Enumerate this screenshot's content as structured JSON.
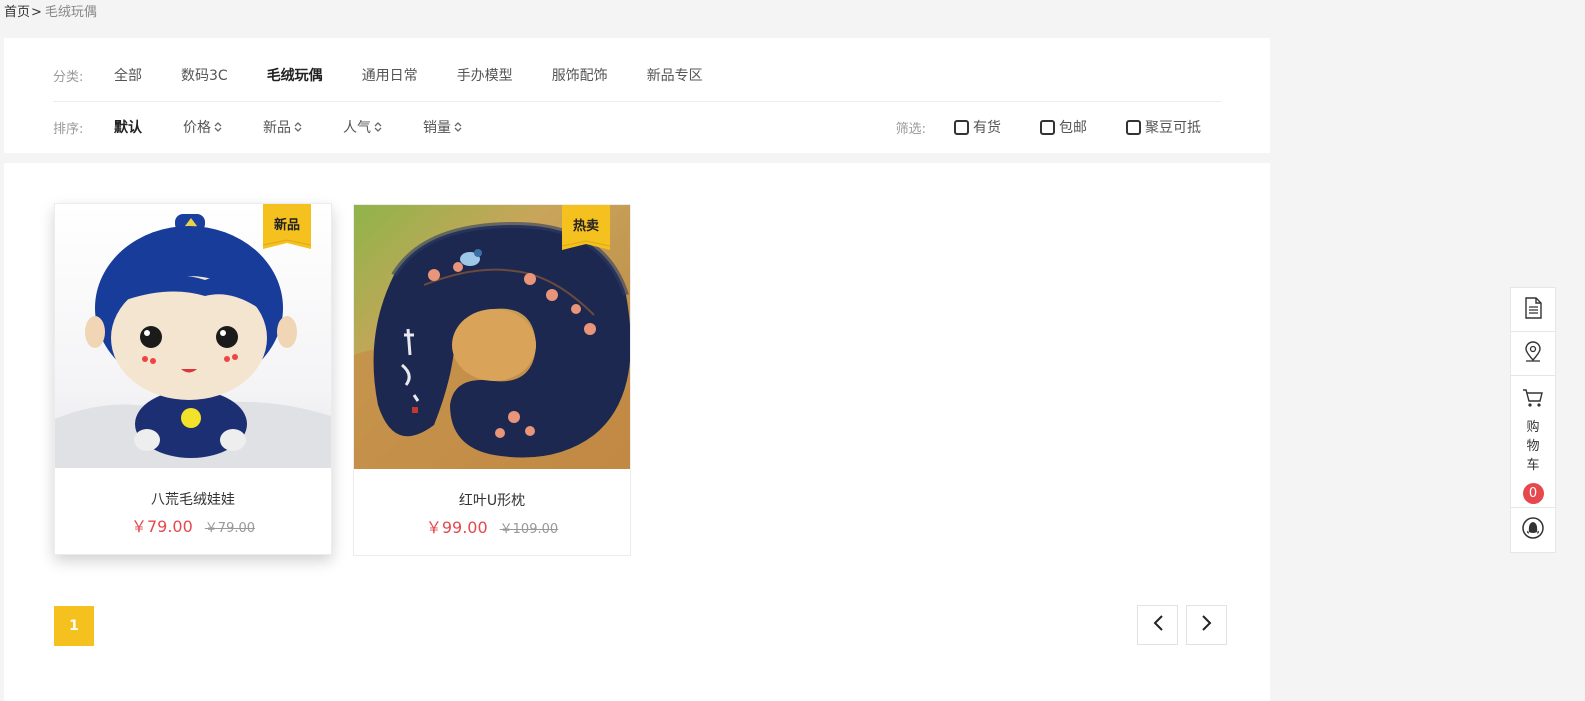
{
  "breadcrumb": {
    "home": "首页",
    "separator": ">",
    "current": "毛绒玩偶"
  },
  "categories": {
    "label": "分类:",
    "items": [
      "全部",
      "数码3C",
      "毛绒玩偶",
      "通用日常",
      "手办模型",
      "服饰配饰",
      "新品专区"
    ],
    "active_index": 2
  },
  "sort": {
    "label": "排序:",
    "items": [
      "默认",
      "价格",
      "新品",
      "人气",
      "销量"
    ],
    "active_index": 0
  },
  "filters": {
    "label": "筛选:",
    "options": [
      {
        "label": "有货",
        "checked": false
      },
      {
        "label": "包邮",
        "checked": false
      },
      {
        "label": "聚豆可抵",
        "checked": false
      }
    ]
  },
  "products": [
    {
      "name": "八荒毛绒娃娃",
      "price": "￥79.00",
      "original_price": "￥79.00",
      "badge": "新品"
    },
    {
      "name": "红叶U形枕",
      "price": "￥99.00",
      "original_price": "￥109.00",
      "badge": "热卖"
    }
  ],
  "pagination": {
    "current_page": "1"
  },
  "sidebar": {
    "cart_label": "购物车",
    "cart_count": "0",
    "icons": [
      "document-icon",
      "location-pin-icon",
      "cart-icon",
      "qq-penguin-icon"
    ]
  },
  "colors": {
    "accent": "#f5c11f",
    "price": "#e5484d",
    "background": "#f4f4f4"
  }
}
